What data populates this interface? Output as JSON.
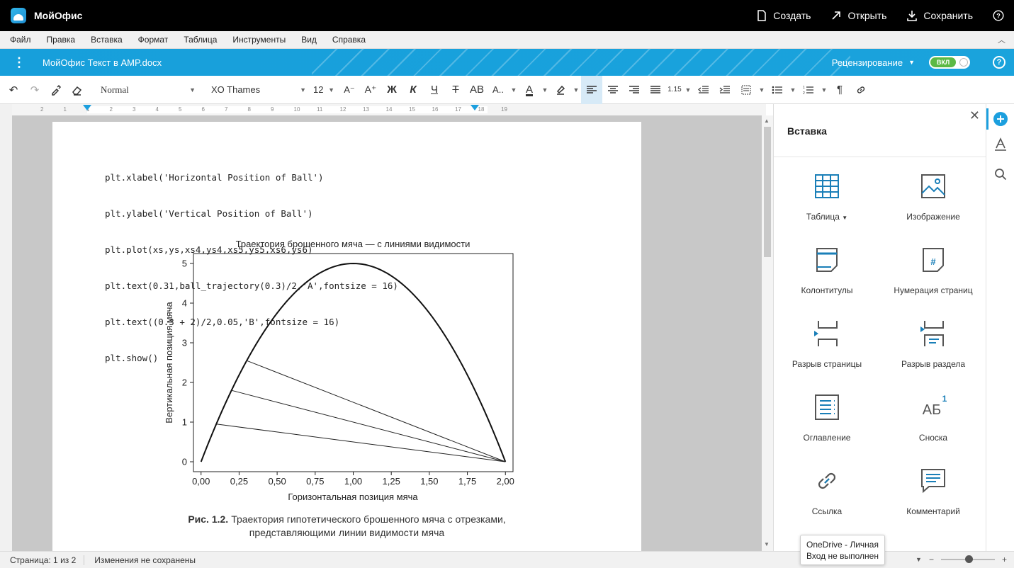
{
  "app": {
    "name": "МойОфис"
  },
  "titlebar": {
    "create": "Создать",
    "open": "Открыть",
    "save": "Сохранить",
    "help": "?"
  },
  "menu": [
    "Файл",
    "Правка",
    "Вставка",
    "Формат",
    "Таблица",
    "Инструменты",
    "Вид",
    "Справка"
  ],
  "docbar": {
    "doc_name": "МойОфис Текст в AMP.docx",
    "review_label": "Рецензирование",
    "toggle_label": "ВКЛ",
    "help": "?"
  },
  "toolbar": {
    "style": "Normal",
    "font": "XO Thames",
    "size": "12",
    "bold": "Ж",
    "italic": "К",
    "underline": "Ч",
    "strike": "Т",
    "caps": "AB",
    "small": "А..",
    "line_spacing": "1.15",
    "pilcrow": "¶"
  },
  "ruler": {
    "ticks": [
      "2",
      "1",
      "1",
      "2",
      "3",
      "4",
      "5",
      "6",
      "7",
      "8",
      "9",
      "10",
      "11",
      "12",
      "13",
      "14",
      "15",
      "16",
      "17",
      "18",
      "19"
    ]
  },
  "document": {
    "code_lines": [
      "plt.xlabel('Horizontal Position of Ball')",
      "plt.ylabel('Vertical Position of Ball')",
      "plt.plot(xs,ys,xs4,ys4,xs5,ys5,xs6,ys6)",
      "plt.text(0.31,ball_trajectory(0.3)/2,'A',fontsize = 16)",
      "plt.text((0.3 + 2)/2,0.05,'B',fontsize = 16)",
      "plt.show()"
    ],
    "caption_bold": "Рис. 1.2.",
    "caption_line1": "Траектория гипотетического брошенного мяча с отрезками,",
    "caption_line2": "представляющими линии видимости мяча"
  },
  "chart_data": {
    "type": "line",
    "title": "Траектория брошенного мяча — с линиями видимости",
    "xlabel": "Горизонтальная позиция мяча",
    "ylabel": "Вертикальная позиция мяча",
    "xlim": [
      -0.05,
      2.05
    ],
    "ylim": [
      -0.25,
      5.25
    ],
    "xticks": [
      "0,00",
      "0,25",
      "0,50",
      "0,75",
      "1,00",
      "1,25",
      "1,50",
      "1,75",
      "2,00"
    ],
    "xtick_values": [
      0,
      0.25,
      0.5,
      0.75,
      1.0,
      1.25,
      1.5,
      1.75,
      2.0
    ],
    "yticks": [
      "0",
      "1",
      "2",
      "3",
      "4",
      "5"
    ],
    "ytick_values": [
      0,
      1,
      2,
      3,
      4,
      5
    ],
    "grid": false,
    "series": [
      {
        "function": "y = -5x^2 + 10x",
        "x_range": [
          0,
          2
        ]
      },
      {
        "x": [
          0.1,
          2.0
        ],
        "y": [
          0.95,
          0
        ]
      },
      {
        "x": [
          0.2,
          2.0
        ],
        "y": [
          1.8,
          0
        ]
      },
      {
        "x": [
          0.3,
          2.0
        ],
        "y": [
          2.55,
          0
        ]
      }
    ]
  },
  "panel": {
    "title": "Вставка",
    "items": [
      {
        "label": "Таблица",
        "icon": "table-icon",
        "dropdown": true
      },
      {
        "label": "Изображение",
        "icon": "image-icon"
      },
      {
        "label": "Колонтитулы",
        "icon": "header-footer-icon"
      },
      {
        "label": "Нумерация страниц",
        "icon": "page-numbering-icon"
      },
      {
        "label": "Разрыв страницы",
        "icon": "page-break-icon"
      },
      {
        "label": "Разрыв раздела",
        "icon": "section-break-icon"
      },
      {
        "label": "Оглавление",
        "icon": "toc-icon"
      },
      {
        "label": "Сноска",
        "icon": "footnote-icon"
      },
      {
        "label": "Ссылка",
        "icon": "link-icon"
      },
      {
        "label": "Комментарий",
        "icon": "comment-icon"
      }
    ],
    "footnote_glyph": "АБ",
    "footnote_sup": "1"
  },
  "status": {
    "page": "Страница: 1 из 2",
    "save_state": "Изменения не сохранены"
  },
  "tooltip": {
    "line1": "OneDrive - Личная",
    "line2": "Вход не выполнен"
  },
  "colors": {
    "accent": "#1c9fde",
    "titlebar": "#000000",
    "toggle_on": "#5cb945"
  }
}
